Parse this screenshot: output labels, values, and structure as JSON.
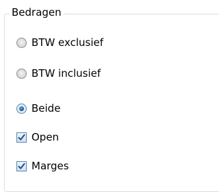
{
  "group": {
    "title": "Bedragen"
  },
  "options": {
    "btw_exclusief": {
      "label": "BTW exclusief",
      "selected": false
    },
    "btw_inclusief": {
      "label": "BTW inclusief",
      "selected": false
    },
    "beide": {
      "label": "Beide",
      "selected": true
    }
  },
  "checkboxes": {
    "open": {
      "label": "Open",
      "checked": true
    },
    "marges": {
      "label": "Marges",
      "checked": true
    }
  },
  "colors": {
    "group_border": "#d5dfe5",
    "accent": "#1f5c99"
  },
  "icons": {
    "radio": "radio-button",
    "checkbox": "checkbox-checkmark"
  }
}
